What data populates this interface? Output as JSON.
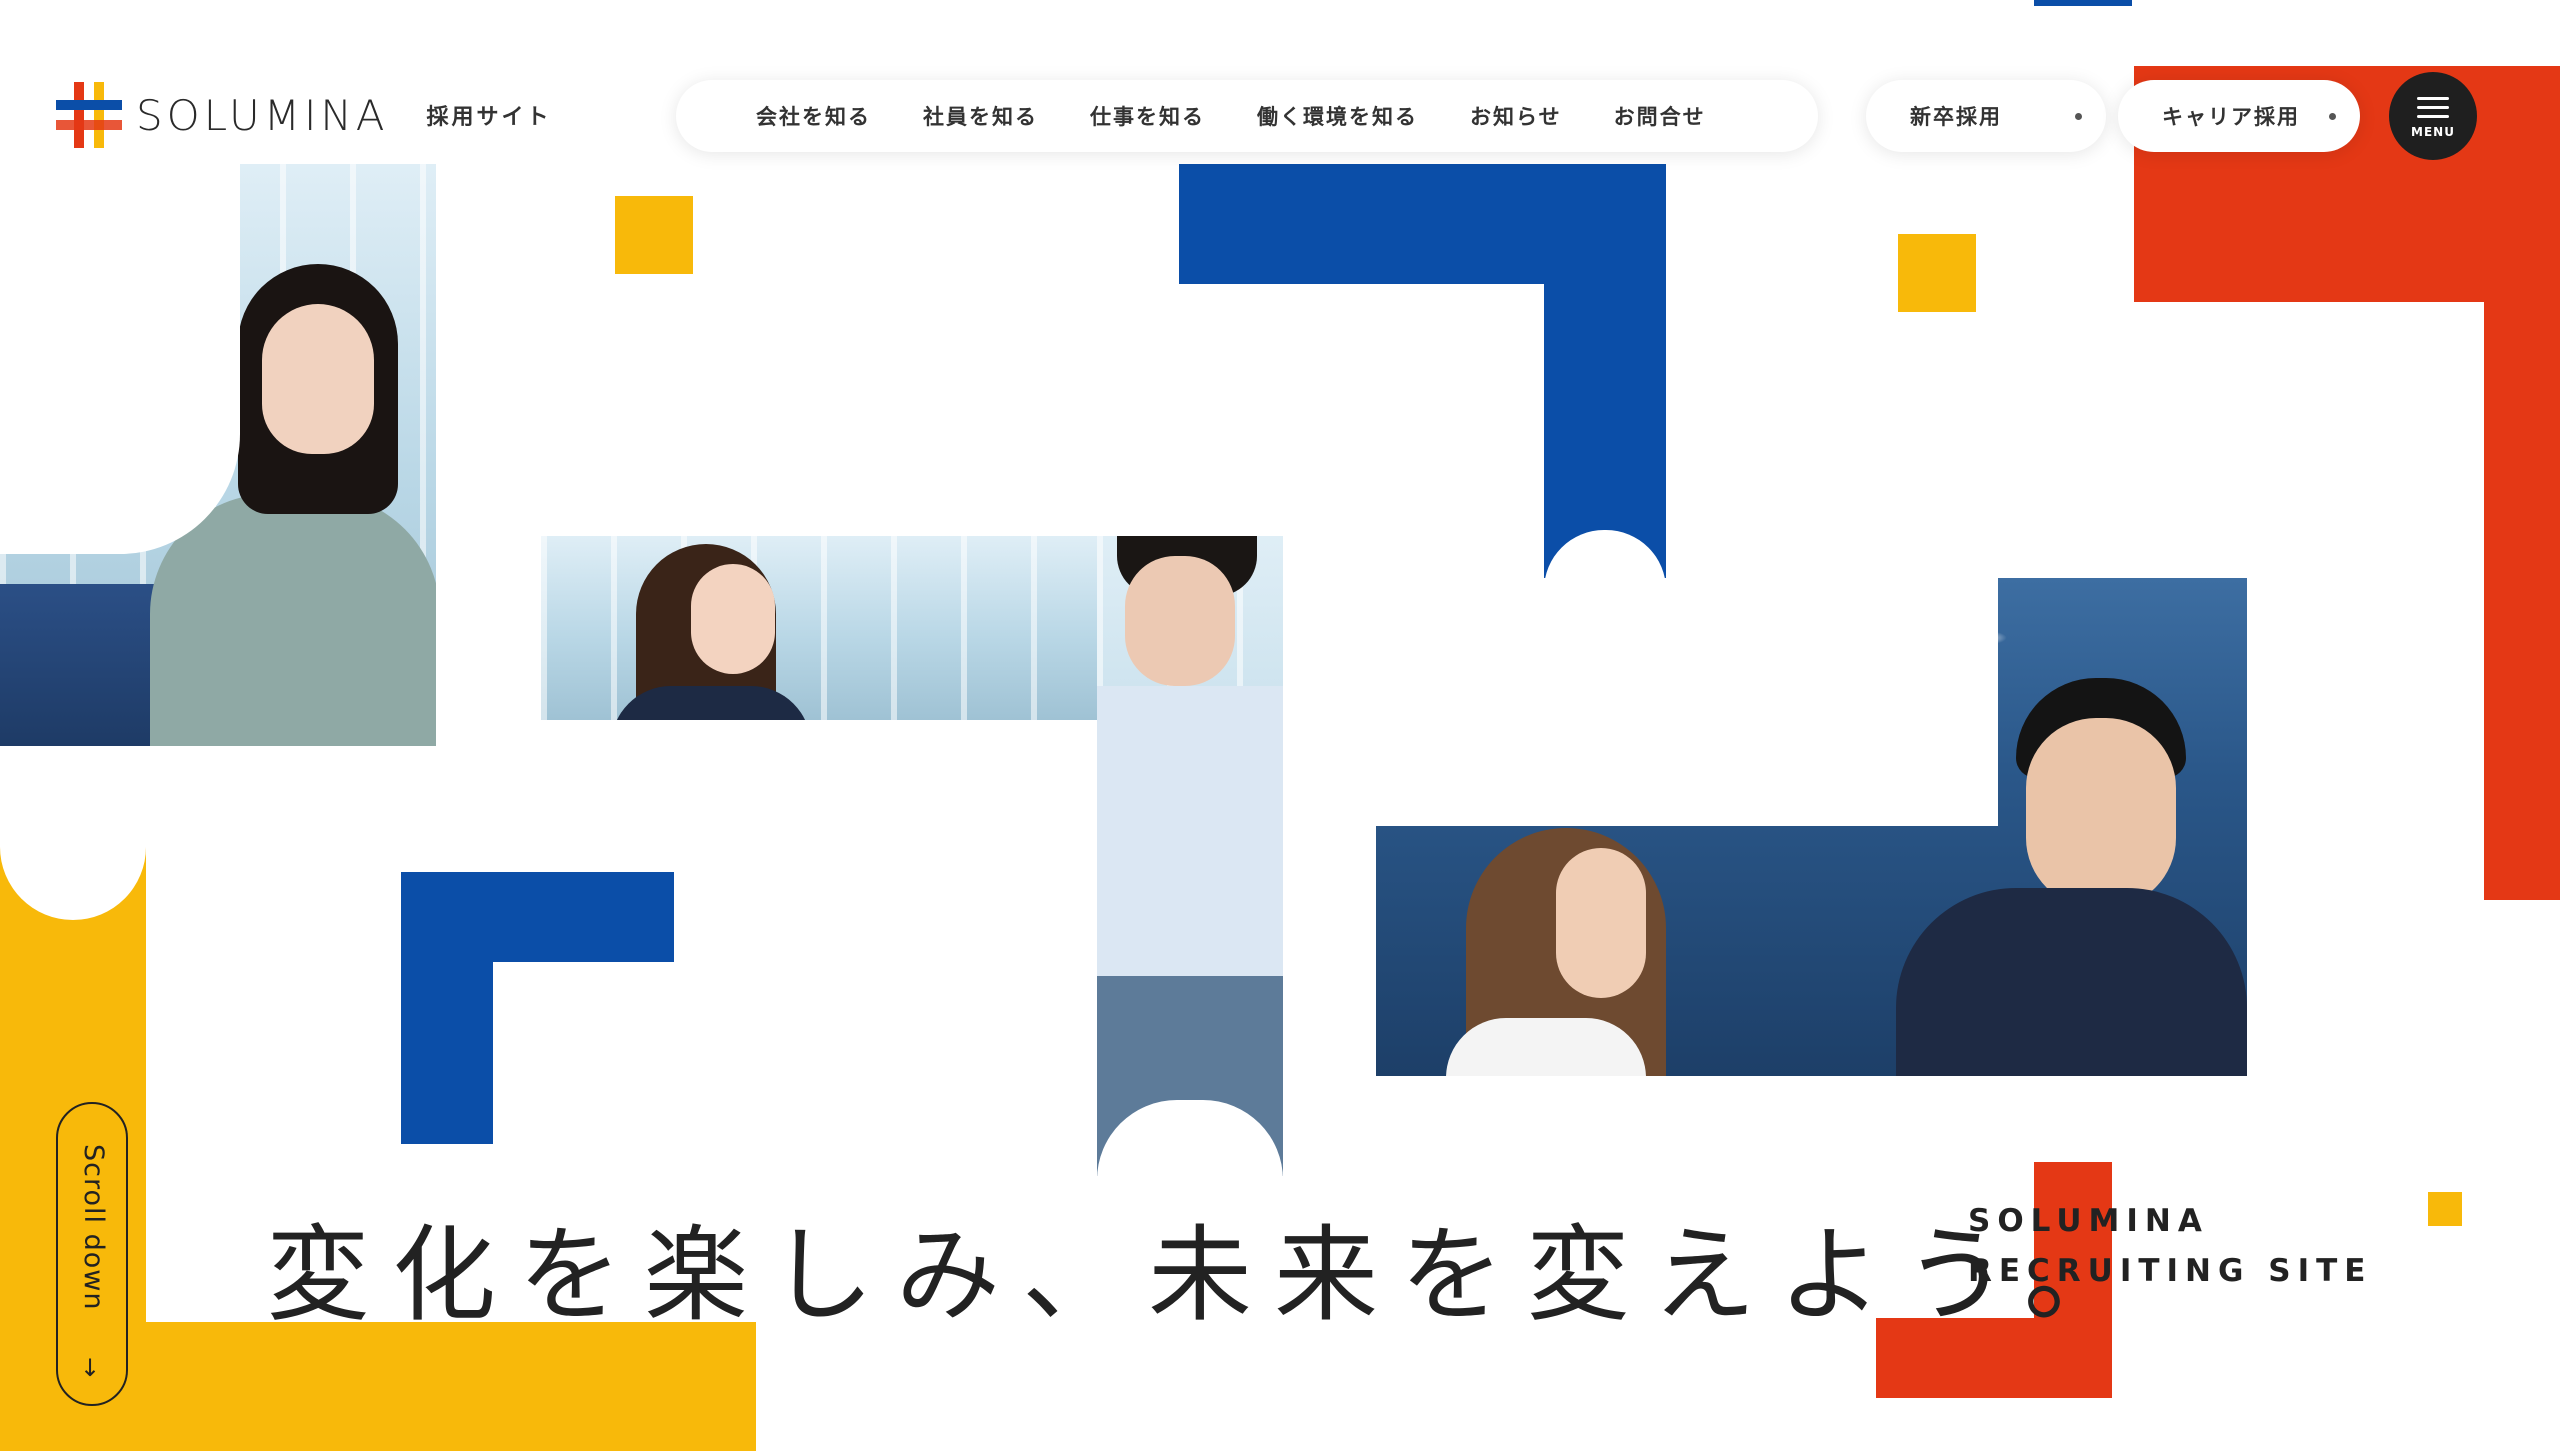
{
  "brand": {
    "name": "SOLUMINA",
    "site_label": "採用サイト"
  },
  "global_nav": [
    {
      "label": "会社を知る"
    },
    {
      "label": "社員を知る"
    },
    {
      "label": "仕事を知る"
    },
    {
      "label": "働く環境を知る"
    },
    {
      "label": "お知らせ"
    },
    {
      "label": "お問合せ"
    }
  ],
  "entry": {
    "new_grad": "新卒採用",
    "career": "キャリア採用"
  },
  "menu": {
    "label": "MENU",
    "icon": "hamburger-icon"
  },
  "hero": {
    "catchcopy": "変化を楽しみ、未来を変えよう。",
    "subtitle_line1": "SOLUMINA",
    "subtitle_line2": "RECRUITING SITE"
  },
  "scroll": {
    "label": "Scroll down",
    "icon": "arrow-down-icon"
  },
  "colors": {
    "blue": "#0b4ea8",
    "red": "#e43815",
    "yellow": "#f8b90a",
    "dark": "#1f1f1f"
  }
}
